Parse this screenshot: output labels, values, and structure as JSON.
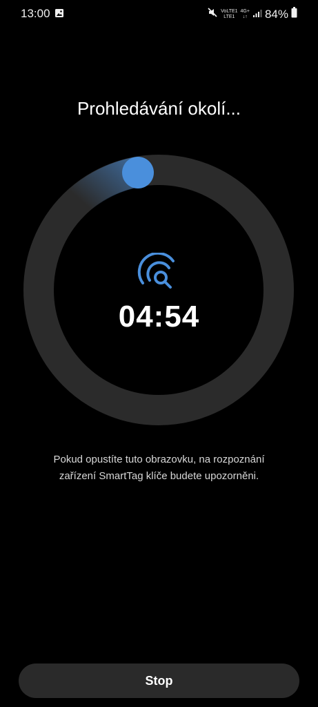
{
  "status_bar": {
    "time": "13:00",
    "network_top": "VoLTE1",
    "network_bottom": "LTE1",
    "network_type": "4G+",
    "battery": "84%",
    "icons": [
      "gallery-icon",
      "mute-icon",
      "signal-icon",
      "battery-icon"
    ]
  },
  "scan": {
    "title": "Prohledávání okolí...",
    "timer": "04:54",
    "icon": "radar-search-icon",
    "accent_color": "#4a8fdc",
    "ring_color": "#2b2b2b"
  },
  "info": {
    "line1": "Pokud opustíte tuto obrazovku, na rozpoznání",
    "line2": "zařízení SmartTag klíče budete upozorněni."
  },
  "actions": {
    "stop_label": "Stop"
  }
}
